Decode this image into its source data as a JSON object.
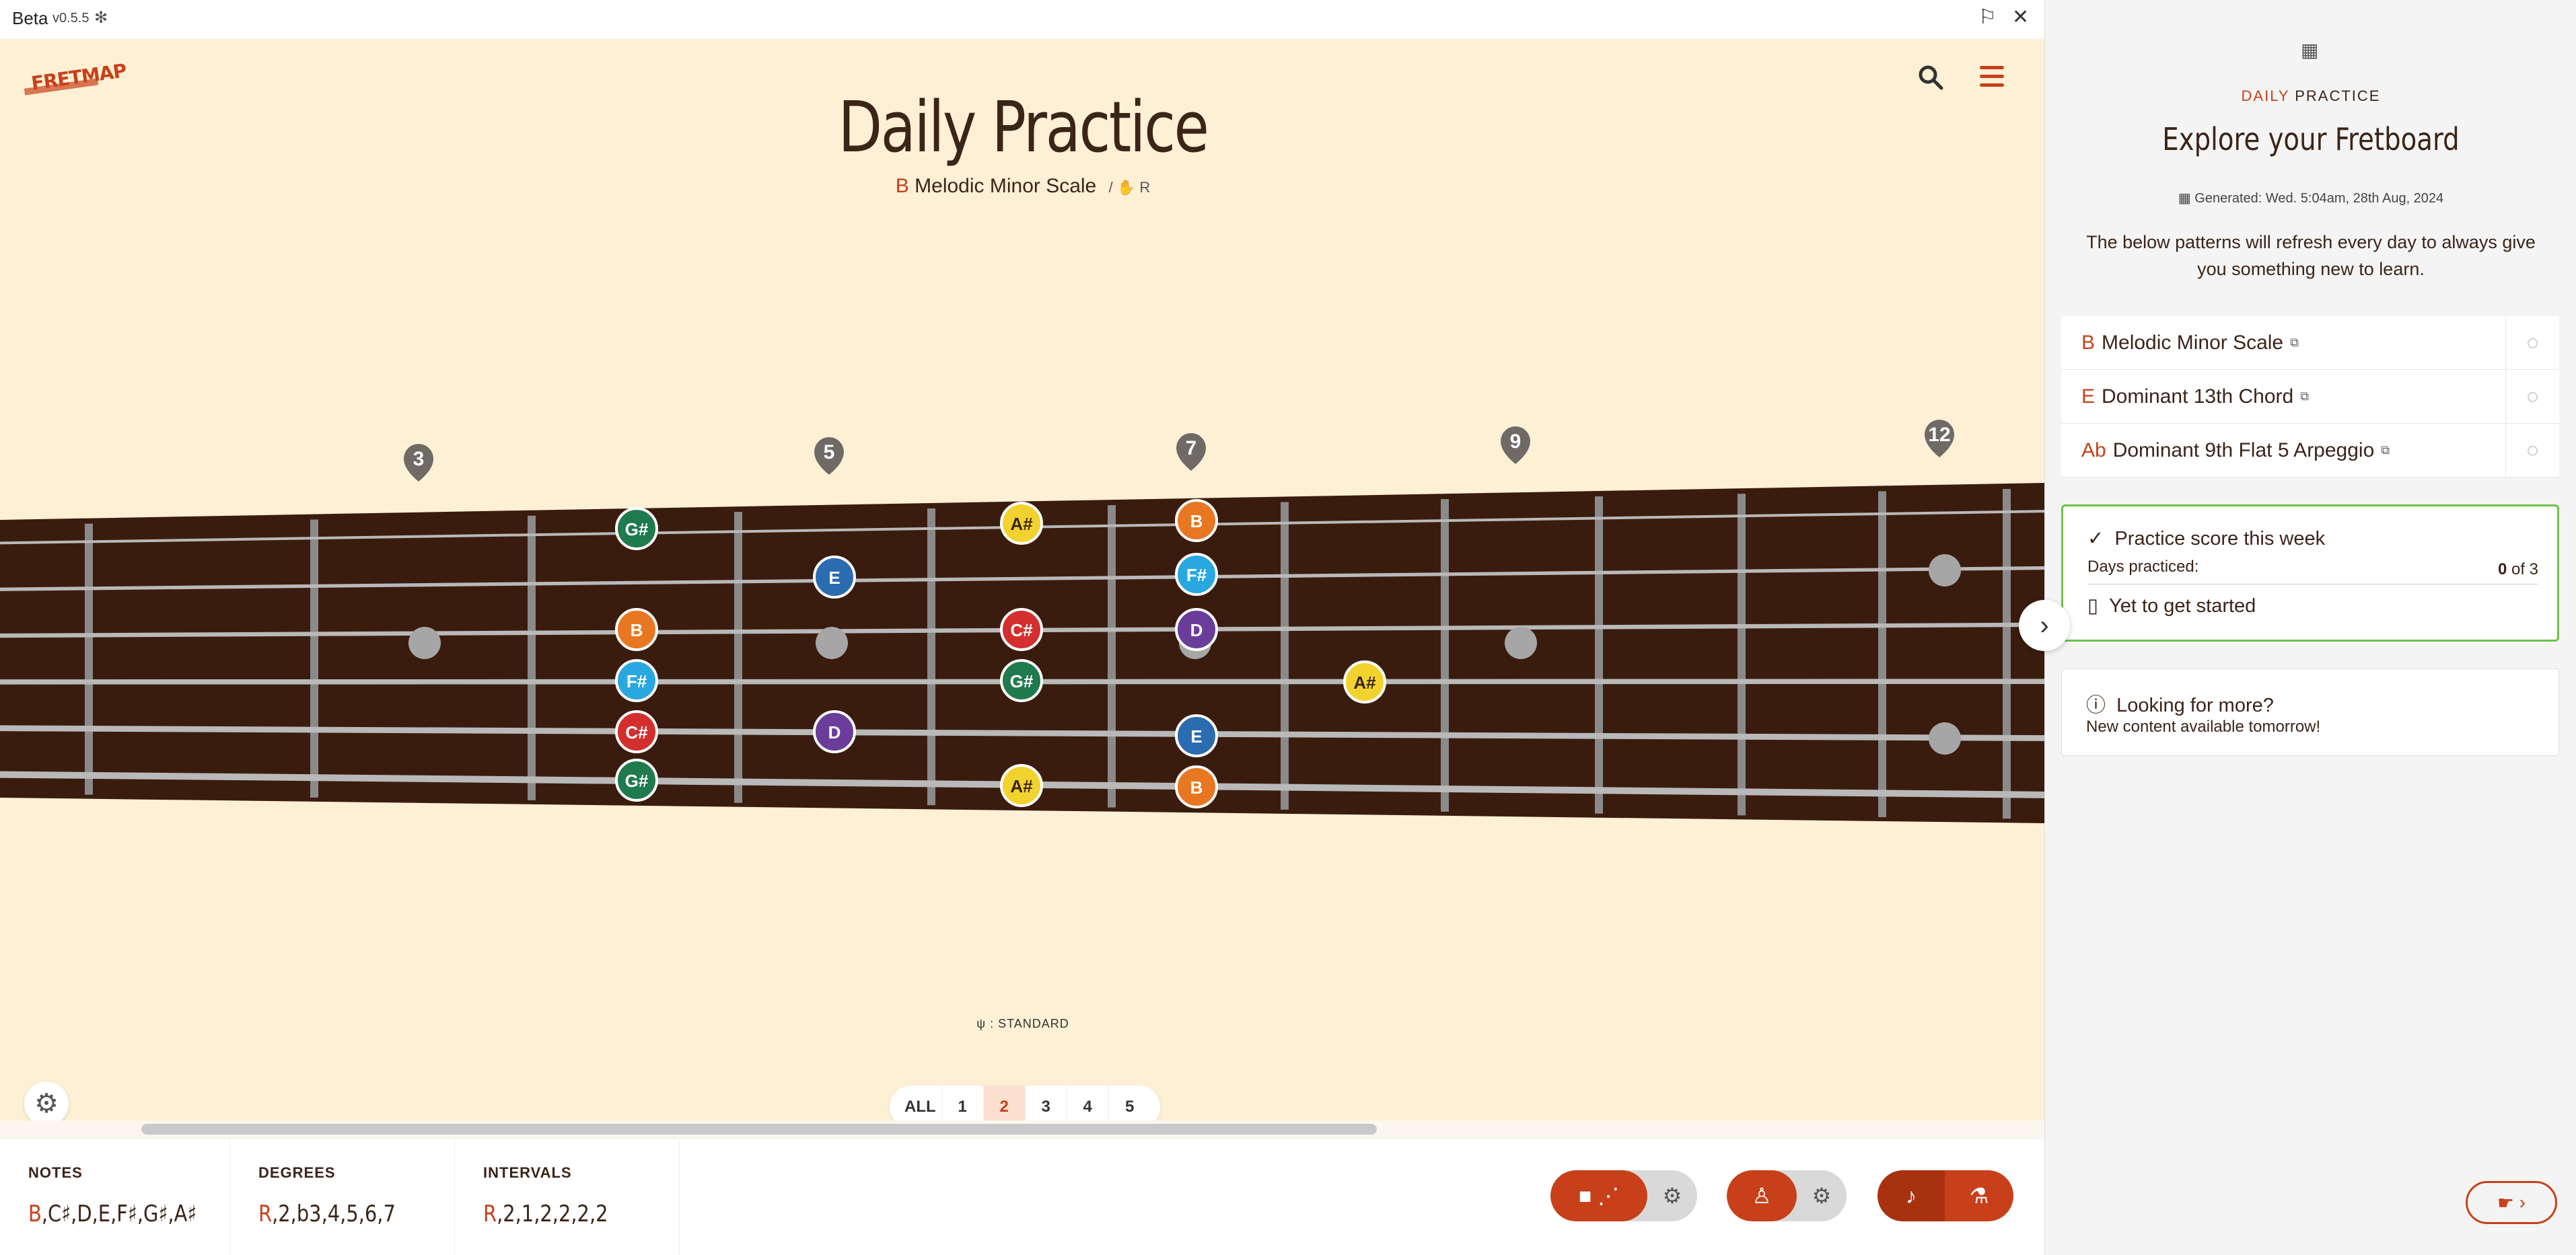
{
  "titlebar": {
    "app": "Beta",
    "version": "v0.5.5"
  },
  "header": {
    "title": "Daily Practice",
    "subtitle_root": "B",
    "subtitle_name": "Melodic Minor Scale",
    "subtitle_extra": "/ ✋ R"
  },
  "fretboard": {
    "fret_markers": [
      "3",
      "5",
      "7",
      "9",
      "12"
    ],
    "notes": [
      {
        "label": "G#",
        "color": "#1f7a4d"
      },
      {
        "label": "A#",
        "color": "#f2d22e"
      },
      {
        "label": "B",
        "color": "#e87722"
      },
      {
        "label": "E",
        "color": "#2b6cb0"
      },
      {
        "label": "F#",
        "color": "#29a8e0"
      },
      {
        "label": "B",
        "color": "#e87722"
      },
      {
        "label": "C#",
        "color": "#d32f2f"
      },
      {
        "label": "D",
        "color": "#6a3d9a"
      },
      {
        "label": "F#",
        "color": "#29a8e0"
      },
      {
        "label": "G#",
        "color": "#1f7a4d"
      },
      {
        "label": "A#",
        "color": "#f2d22e"
      },
      {
        "label": "C#",
        "color": "#d32f2f"
      },
      {
        "label": "D",
        "color": "#6a3d9a"
      },
      {
        "label": "E",
        "color": "#2b6cb0"
      },
      {
        "label": "G#",
        "color": "#1f7a4d"
      },
      {
        "label": "A#",
        "color": "#f2d22e"
      },
      {
        "label": "B",
        "color": "#e87722"
      }
    ]
  },
  "tuning": {
    "label": ": STANDARD"
  },
  "positions": {
    "items": [
      "ALL",
      "1",
      "2",
      "3",
      "4",
      "5"
    ],
    "selected": "2"
  },
  "info": {
    "notes_label": "NOTES",
    "notes_root": "B",
    "notes_rest": ",C♯,D,E,F♯,G♯,A♯",
    "degrees_label": "DEGREES",
    "degrees_root": "R",
    "degrees_rest": ",2,b3,4,5,6,7",
    "intervals_label": "INTERVALS",
    "intervals_root": "R",
    "intervals_rest": ",2,1,2,2,2,2"
  },
  "panel": {
    "kicker_1": "DAILY",
    "kicker_2": " PRACTICE",
    "title": "Explore your Fretboard",
    "generated": "Generated: Wed. 5:04am, 28th Aug, 2024",
    "intro": "The below patterns will refresh every day to always give you something new to learn.",
    "patterns": [
      {
        "root": "B",
        "name": "Melodic Minor Scale"
      },
      {
        "root": "E",
        "name": "Dominant 13th Chord"
      },
      {
        "root": "Ab",
        "name": "Dominant 9th Flat 5 Arpeggio"
      }
    ],
    "score": {
      "title": "Practice score this week",
      "days_label": "Days practiced:",
      "days_value": "0",
      "days_total": " of 3",
      "status": "Yet to get started"
    },
    "more": {
      "title": "Looking for more?",
      "sub": "New content available tomorrow!"
    }
  },
  "colors": {
    "accent": "#c8401a",
    "fretboard": "#3a1c0e",
    "success": "#6cc24a"
  }
}
